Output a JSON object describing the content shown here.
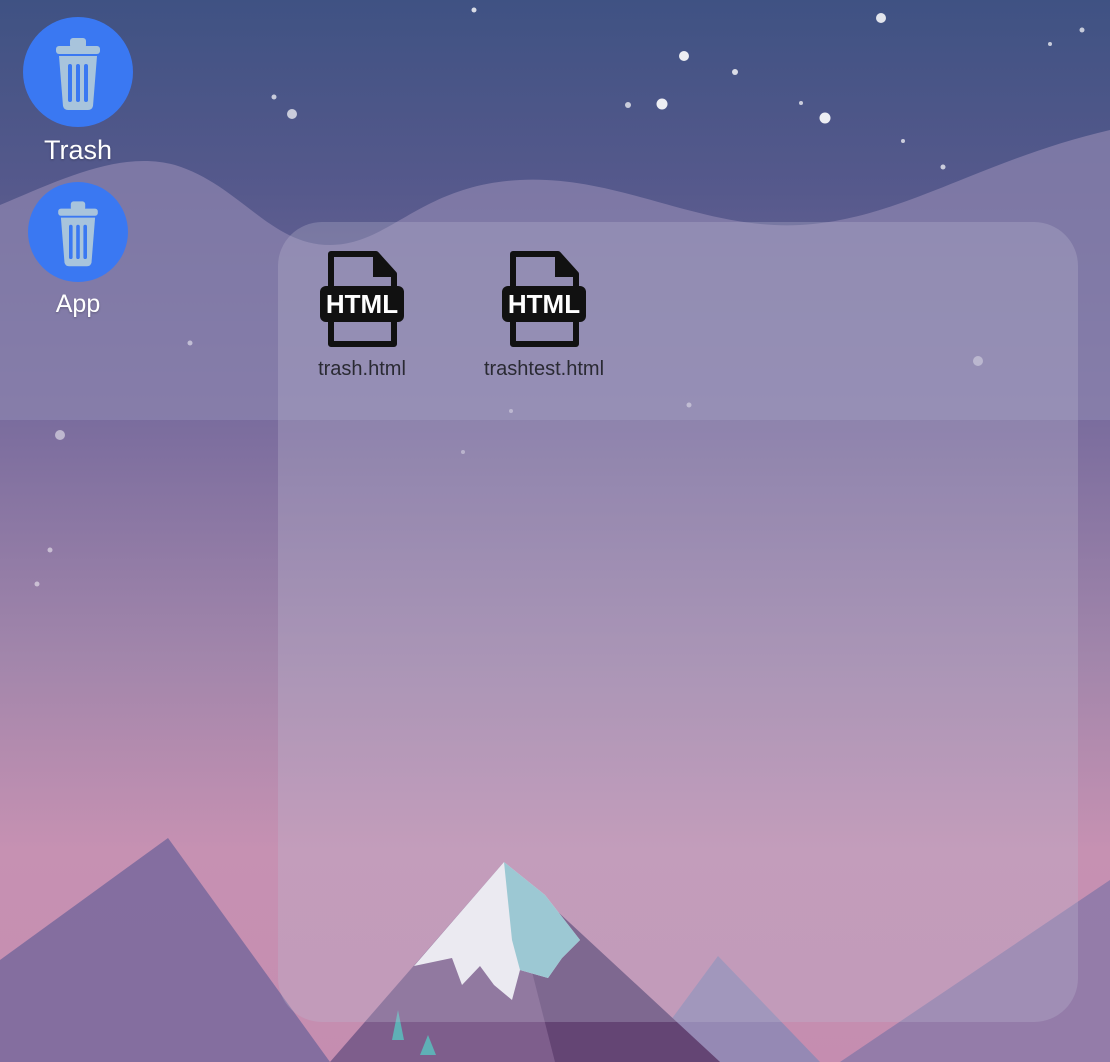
{
  "desktop": {
    "icons": [
      {
        "label": "Trash",
        "icon": "trash-icon"
      },
      {
        "label": "App",
        "icon": "trash-icon"
      }
    ]
  },
  "folder": {
    "files": [
      {
        "name": "trash.html",
        "icon": "html-file-icon",
        "badge": "HTML"
      },
      {
        "name": "trashtest.html",
        "icon": "html-file-icon",
        "badge": "HTML"
      }
    ]
  },
  "colors": {
    "icon_circle": "#3a78f2",
    "trash_glyph": "#a8c4dc",
    "sky_top": "#3f5283",
    "sky_bottom": "#c691b2"
  }
}
